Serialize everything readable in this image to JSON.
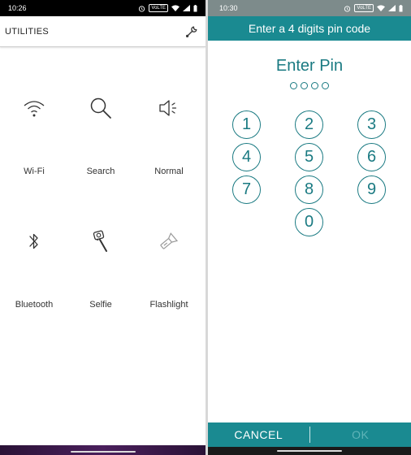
{
  "left": {
    "status": {
      "time": "10:26",
      "volte": "VoLTE"
    },
    "header": {
      "title": "UTILITIES"
    },
    "tiles": [
      {
        "label": "Wi-Fi"
      },
      {
        "label": "Search"
      },
      {
        "label": "Normal"
      },
      {
        "label": "Bluetooth"
      },
      {
        "label": "Selfie"
      },
      {
        "label": "Flashlight"
      }
    ]
  },
  "right": {
    "status": {
      "time": "10:30",
      "volte": "VoLTE"
    },
    "header": {
      "title": "Enter a 4 digits pin code"
    },
    "heading": "Enter Pin",
    "keys": [
      "1",
      "2",
      "3",
      "4",
      "5",
      "6",
      "7",
      "8",
      "9",
      "0"
    ],
    "bottom": {
      "cancel": "CANCEL",
      "ok": "OK"
    }
  },
  "colors": {
    "accent": "#1a8a91",
    "accent_text": "#1a7a82",
    "ok_disabled": "#5fb4b8"
  }
}
